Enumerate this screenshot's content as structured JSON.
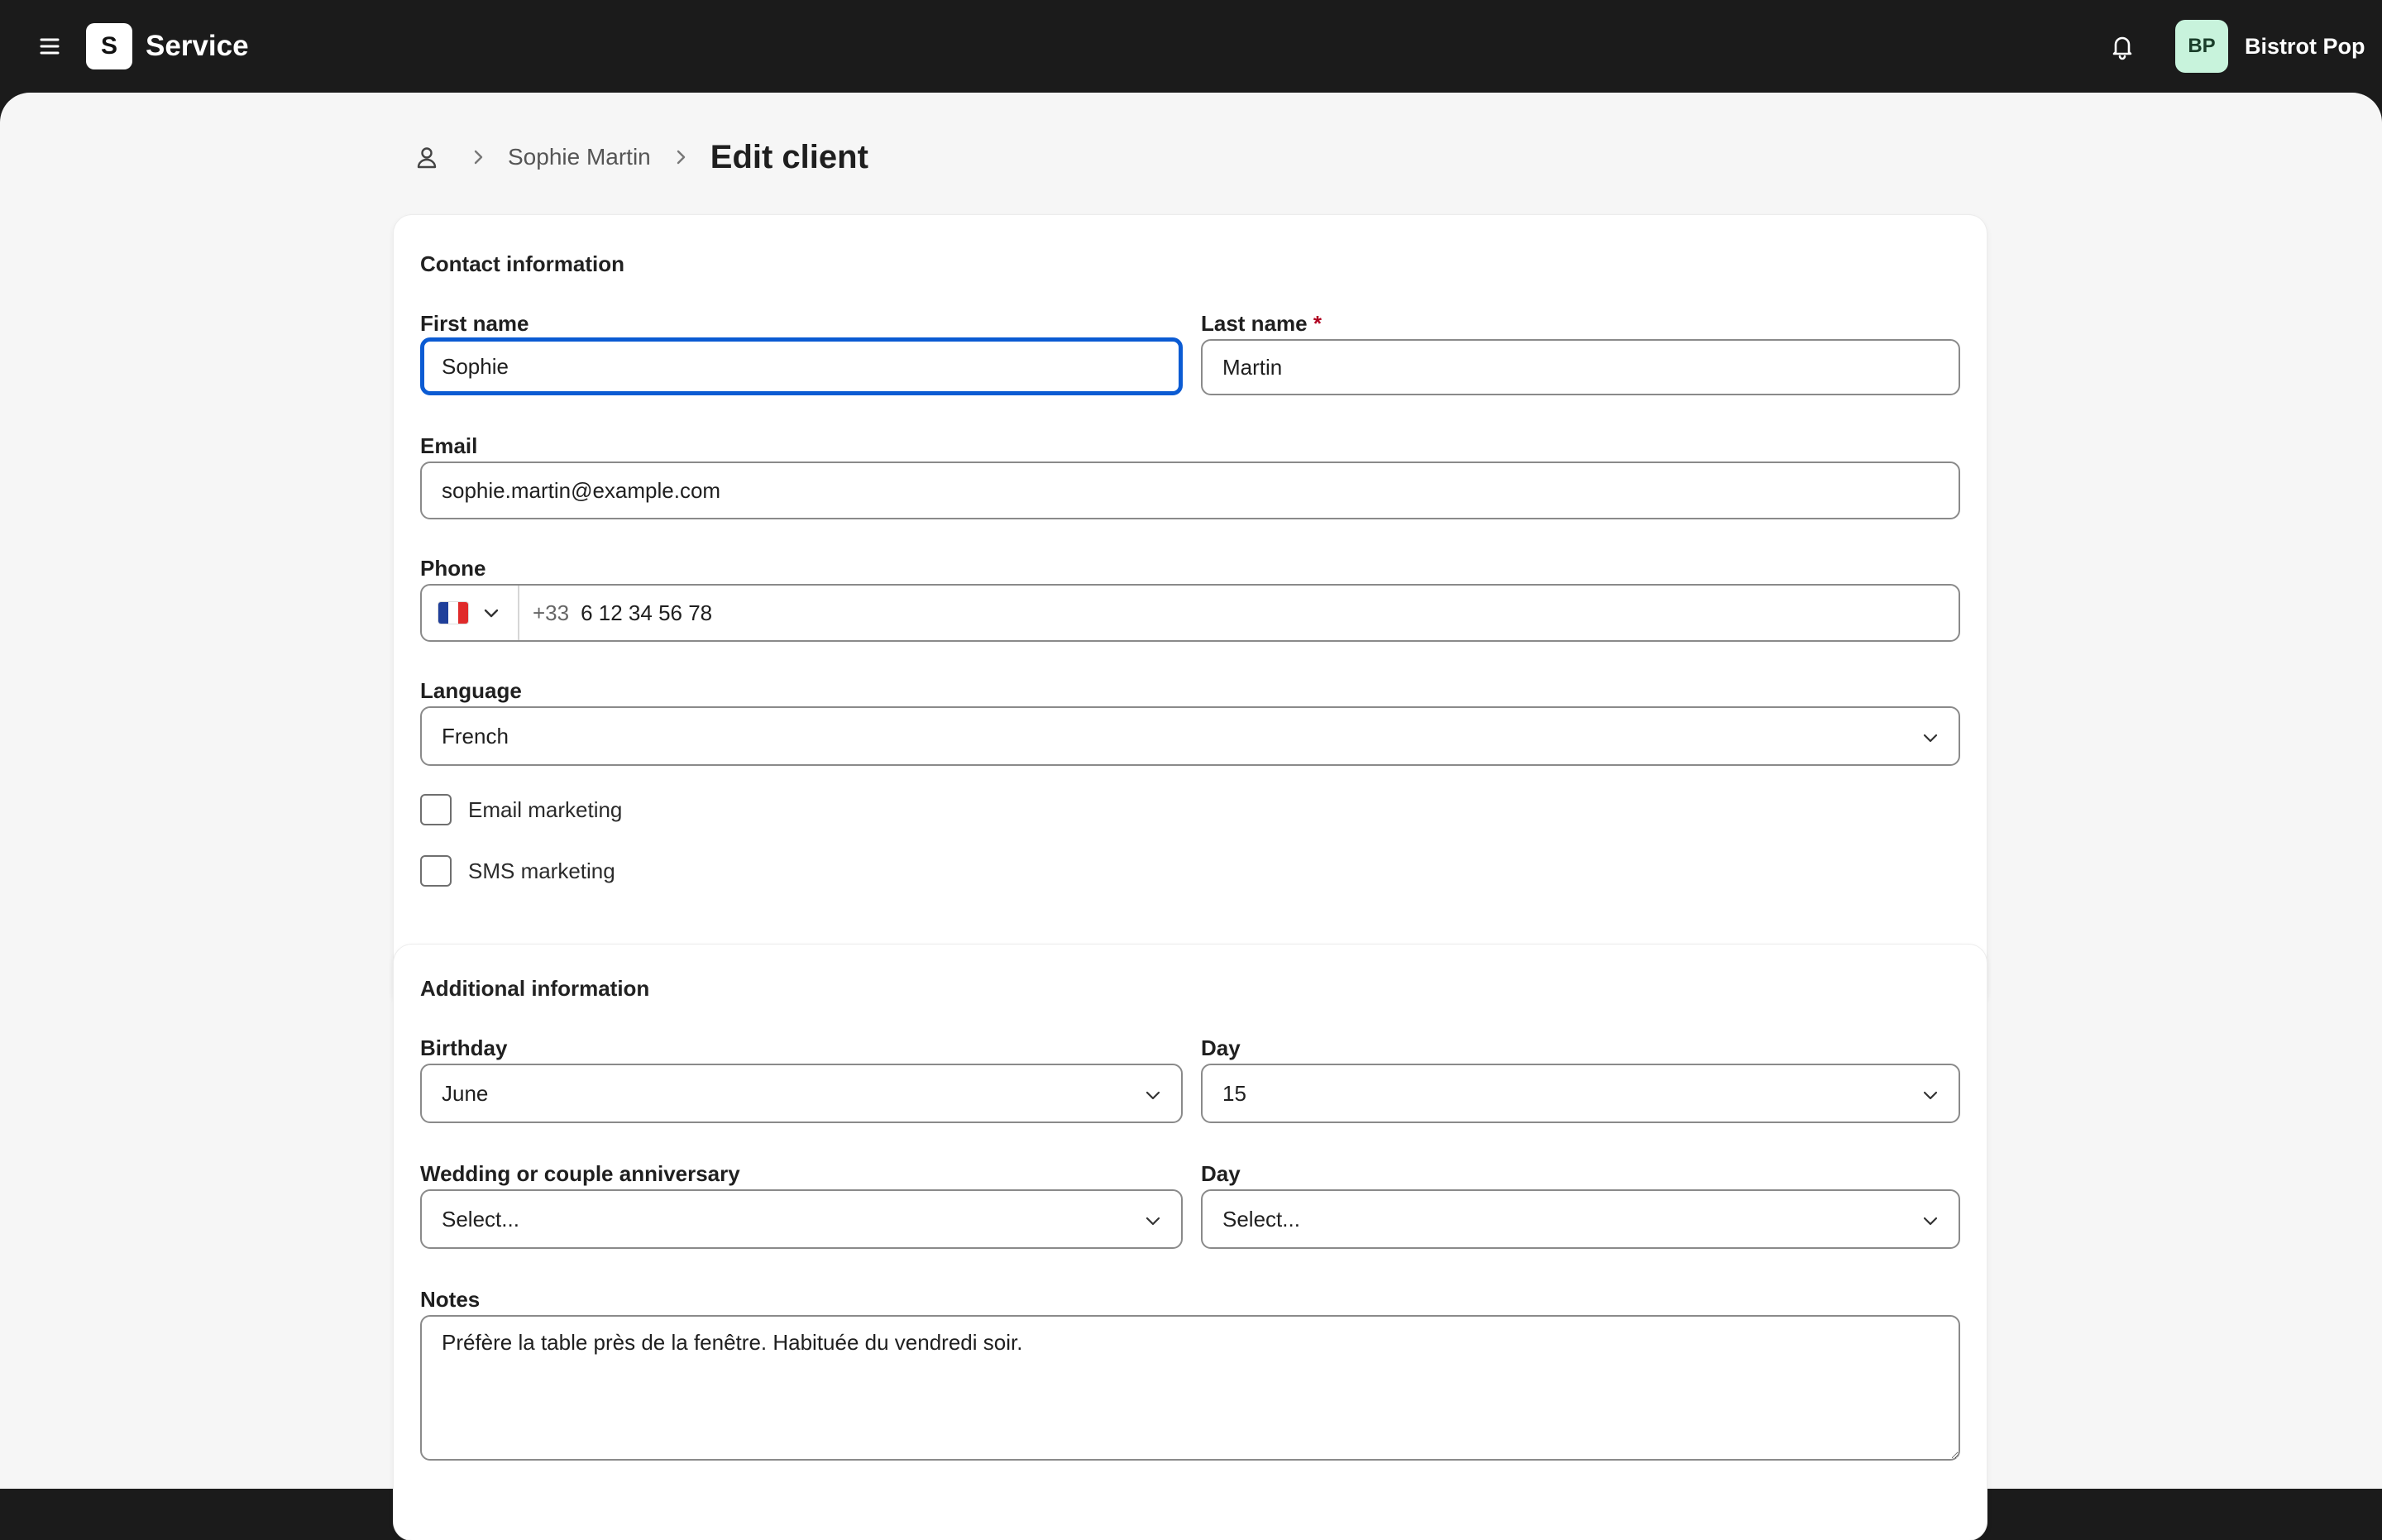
{
  "header": {
    "menu_icon": "menu-icon",
    "logo_letter": "S",
    "app_name": "Service",
    "notifications_icon": "bell-icon",
    "avatar_initials": "BP",
    "account_name": "Bistrot Pop"
  },
  "breadcrumb": {
    "home_icon": "user-icon",
    "parent": "Sophie Martin",
    "current": "Edit client"
  },
  "contact": {
    "title": "Contact information",
    "first_name": {
      "label": "First name",
      "value": "Sophie"
    },
    "last_name": {
      "label": "Last name",
      "required_mark": "*",
      "value": "Martin"
    },
    "email": {
      "label": "Email",
      "value": "sophie.martin@example.com"
    },
    "phone": {
      "label": "Phone",
      "country": "FR",
      "prefix": "+33",
      "value": "6 12 34 56 78"
    },
    "language": {
      "label": "Language",
      "value": "French"
    },
    "email_marketing": {
      "label": "Email marketing",
      "checked": false
    },
    "sms_marketing": {
      "label": "SMS marketing",
      "checked": false
    }
  },
  "additional": {
    "title": "Additional information",
    "birthday": {
      "label": "Birthday",
      "month": "June",
      "day_label": "Day",
      "day": "15"
    },
    "anniversary": {
      "label": "Wedding or couple anniversary",
      "month": "Select...",
      "day_label": "Day",
      "day": "Select..."
    },
    "notes": {
      "label": "Notes",
      "value": "Préfère la table près de la fenêtre. Habituée du vendredi soir."
    }
  },
  "colors": {
    "topbar": "#1b1b1b",
    "page_bg": "#f6f6f6",
    "focus": "#0b5bd3",
    "required": "#b00020",
    "avatar_bg": "#c8f3dc"
  }
}
